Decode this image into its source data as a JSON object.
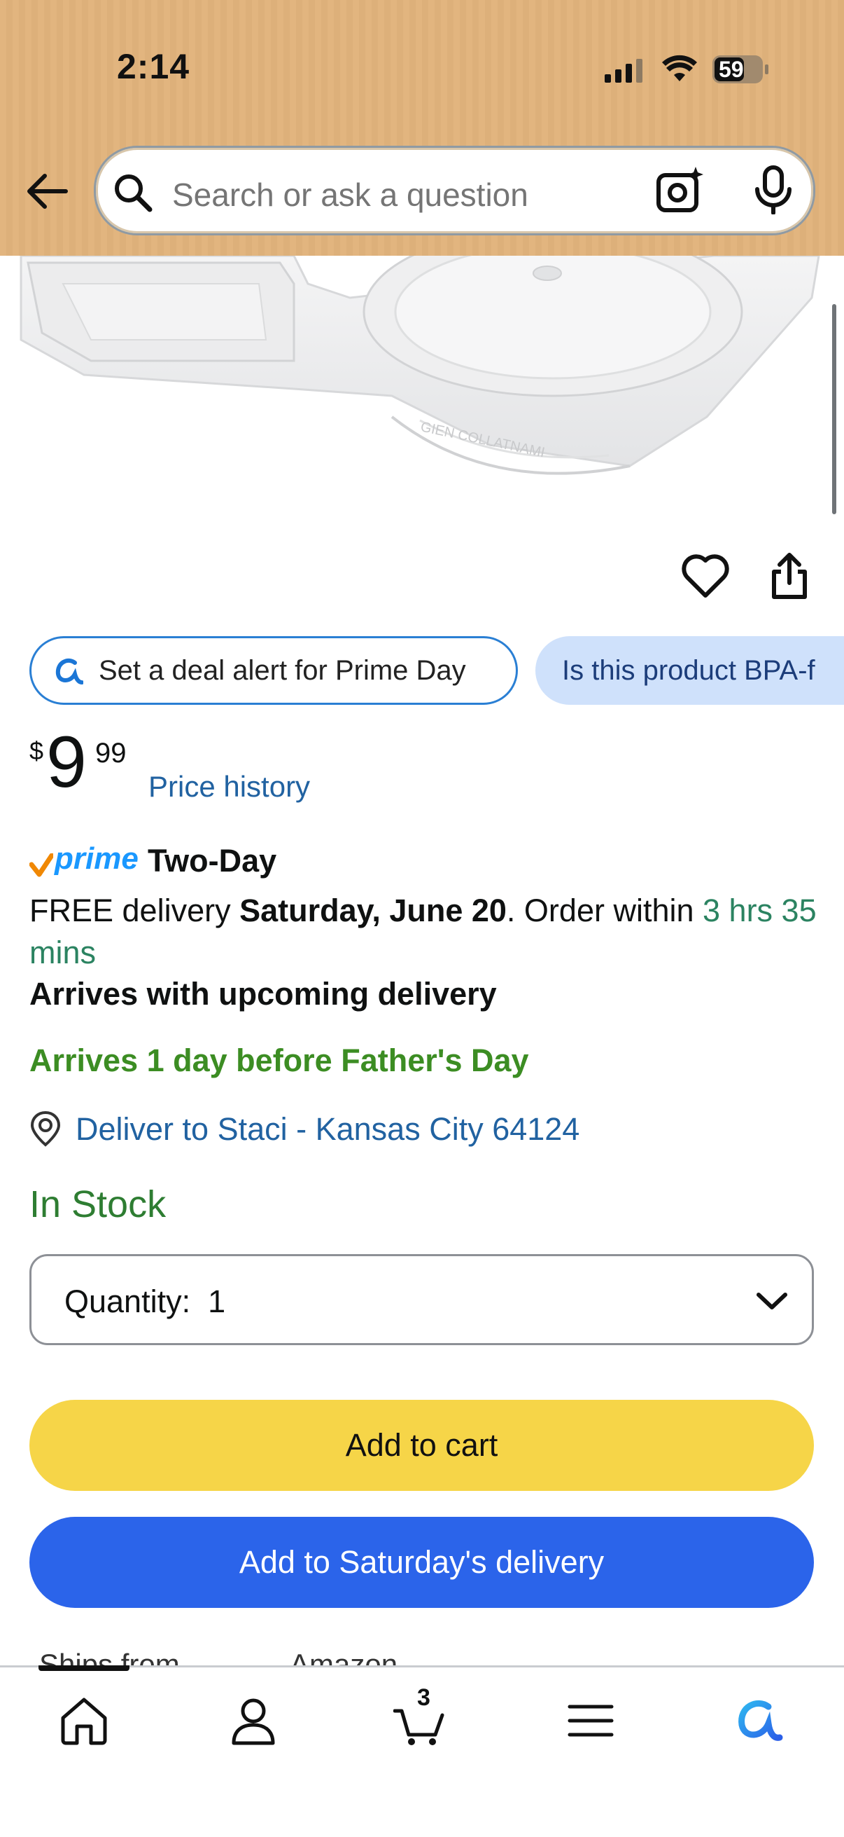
{
  "status_bar": {
    "time": "2:14",
    "battery": "59"
  },
  "search": {
    "placeholder": "Search or ask a question"
  },
  "chips": {
    "deal_alert": "Set a deal alert for Prime Day",
    "bpa_question": "Is this product BPA-f"
  },
  "price": {
    "currency": "$",
    "whole": "9",
    "fraction": "99",
    "history_link": "Price history"
  },
  "delivery": {
    "prime_label": "prime",
    "speed": "Two-Day",
    "free_delivery_prefix": "FREE delivery ",
    "date": "Saturday, June 20",
    "order_within_prefix": ". Order within ",
    "countdown": "3 hrs 35 mins",
    "arrives_upcoming": "Arrives with upcoming delivery",
    "fathers_day": "Arrives 1 day before Father's Day",
    "deliver_to": "Deliver to Staci - Kansas City 64124"
  },
  "stock_status": "In Stock",
  "quantity": {
    "label": "Quantity:",
    "value": "1"
  },
  "buttons": {
    "add_to_cart": "Add to cart",
    "add_to_delivery": "Add to Saturday's delivery"
  },
  "ships_from": {
    "label": "Ships from",
    "value": "Amazon"
  },
  "bottom_nav": {
    "cart_count": "3",
    "items": [
      "home",
      "account",
      "cart",
      "menu",
      "rufus"
    ]
  },
  "colors": {
    "header_bg": "#e2b57f",
    "add_to_cart": "#f6d548",
    "add_to_delivery": "#2b64ea",
    "link": "#2162a1",
    "in_stock": "#2e7d32",
    "fathers_day": "#3c8d23"
  }
}
